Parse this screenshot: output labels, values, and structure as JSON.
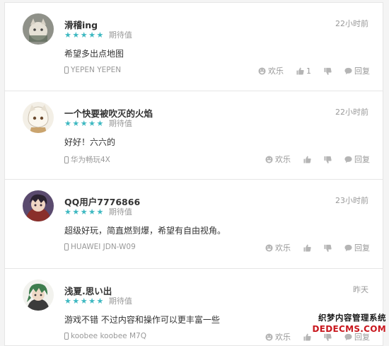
{
  "rating_text": "期待值",
  "actions": {
    "happy": "欢乐",
    "reply": "回复"
  },
  "comments": [
    {
      "user": "滑稽ing",
      "time": "22小时前",
      "content": "希望多出点地图",
      "device": "YEPEN YEPEN",
      "likes": "1",
      "avatar": "avatar-cat"
    },
    {
      "user": "一个快要被吹灭的火焰",
      "time": "22小时前",
      "content": "好好！六六的",
      "device": "华为畅玩4X",
      "likes": "",
      "avatar": "avatar-anime-girl"
    },
    {
      "user": "QQ用户7776866",
      "time": "23小时前",
      "content": "超级好玩，简直燃到爆，希望有自由视角。",
      "device": "HUAWEI JDN-W09",
      "likes": "",
      "avatar": "avatar-anime-boy"
    },
    {
      "user": "浅夏.思い出",
      "time": "昨天",
      "content": "游戏不错 不过内容和操作可以更丰富一些",
      "device": "koobee koobee M7Q",
      "likes": "",
      "avatar": "avatar-green-hair"
    }
  ],
  "watermark": {
    "cn": "织梦内容管理系统",
    "en": "DEDECMS.COM"
  }
}
